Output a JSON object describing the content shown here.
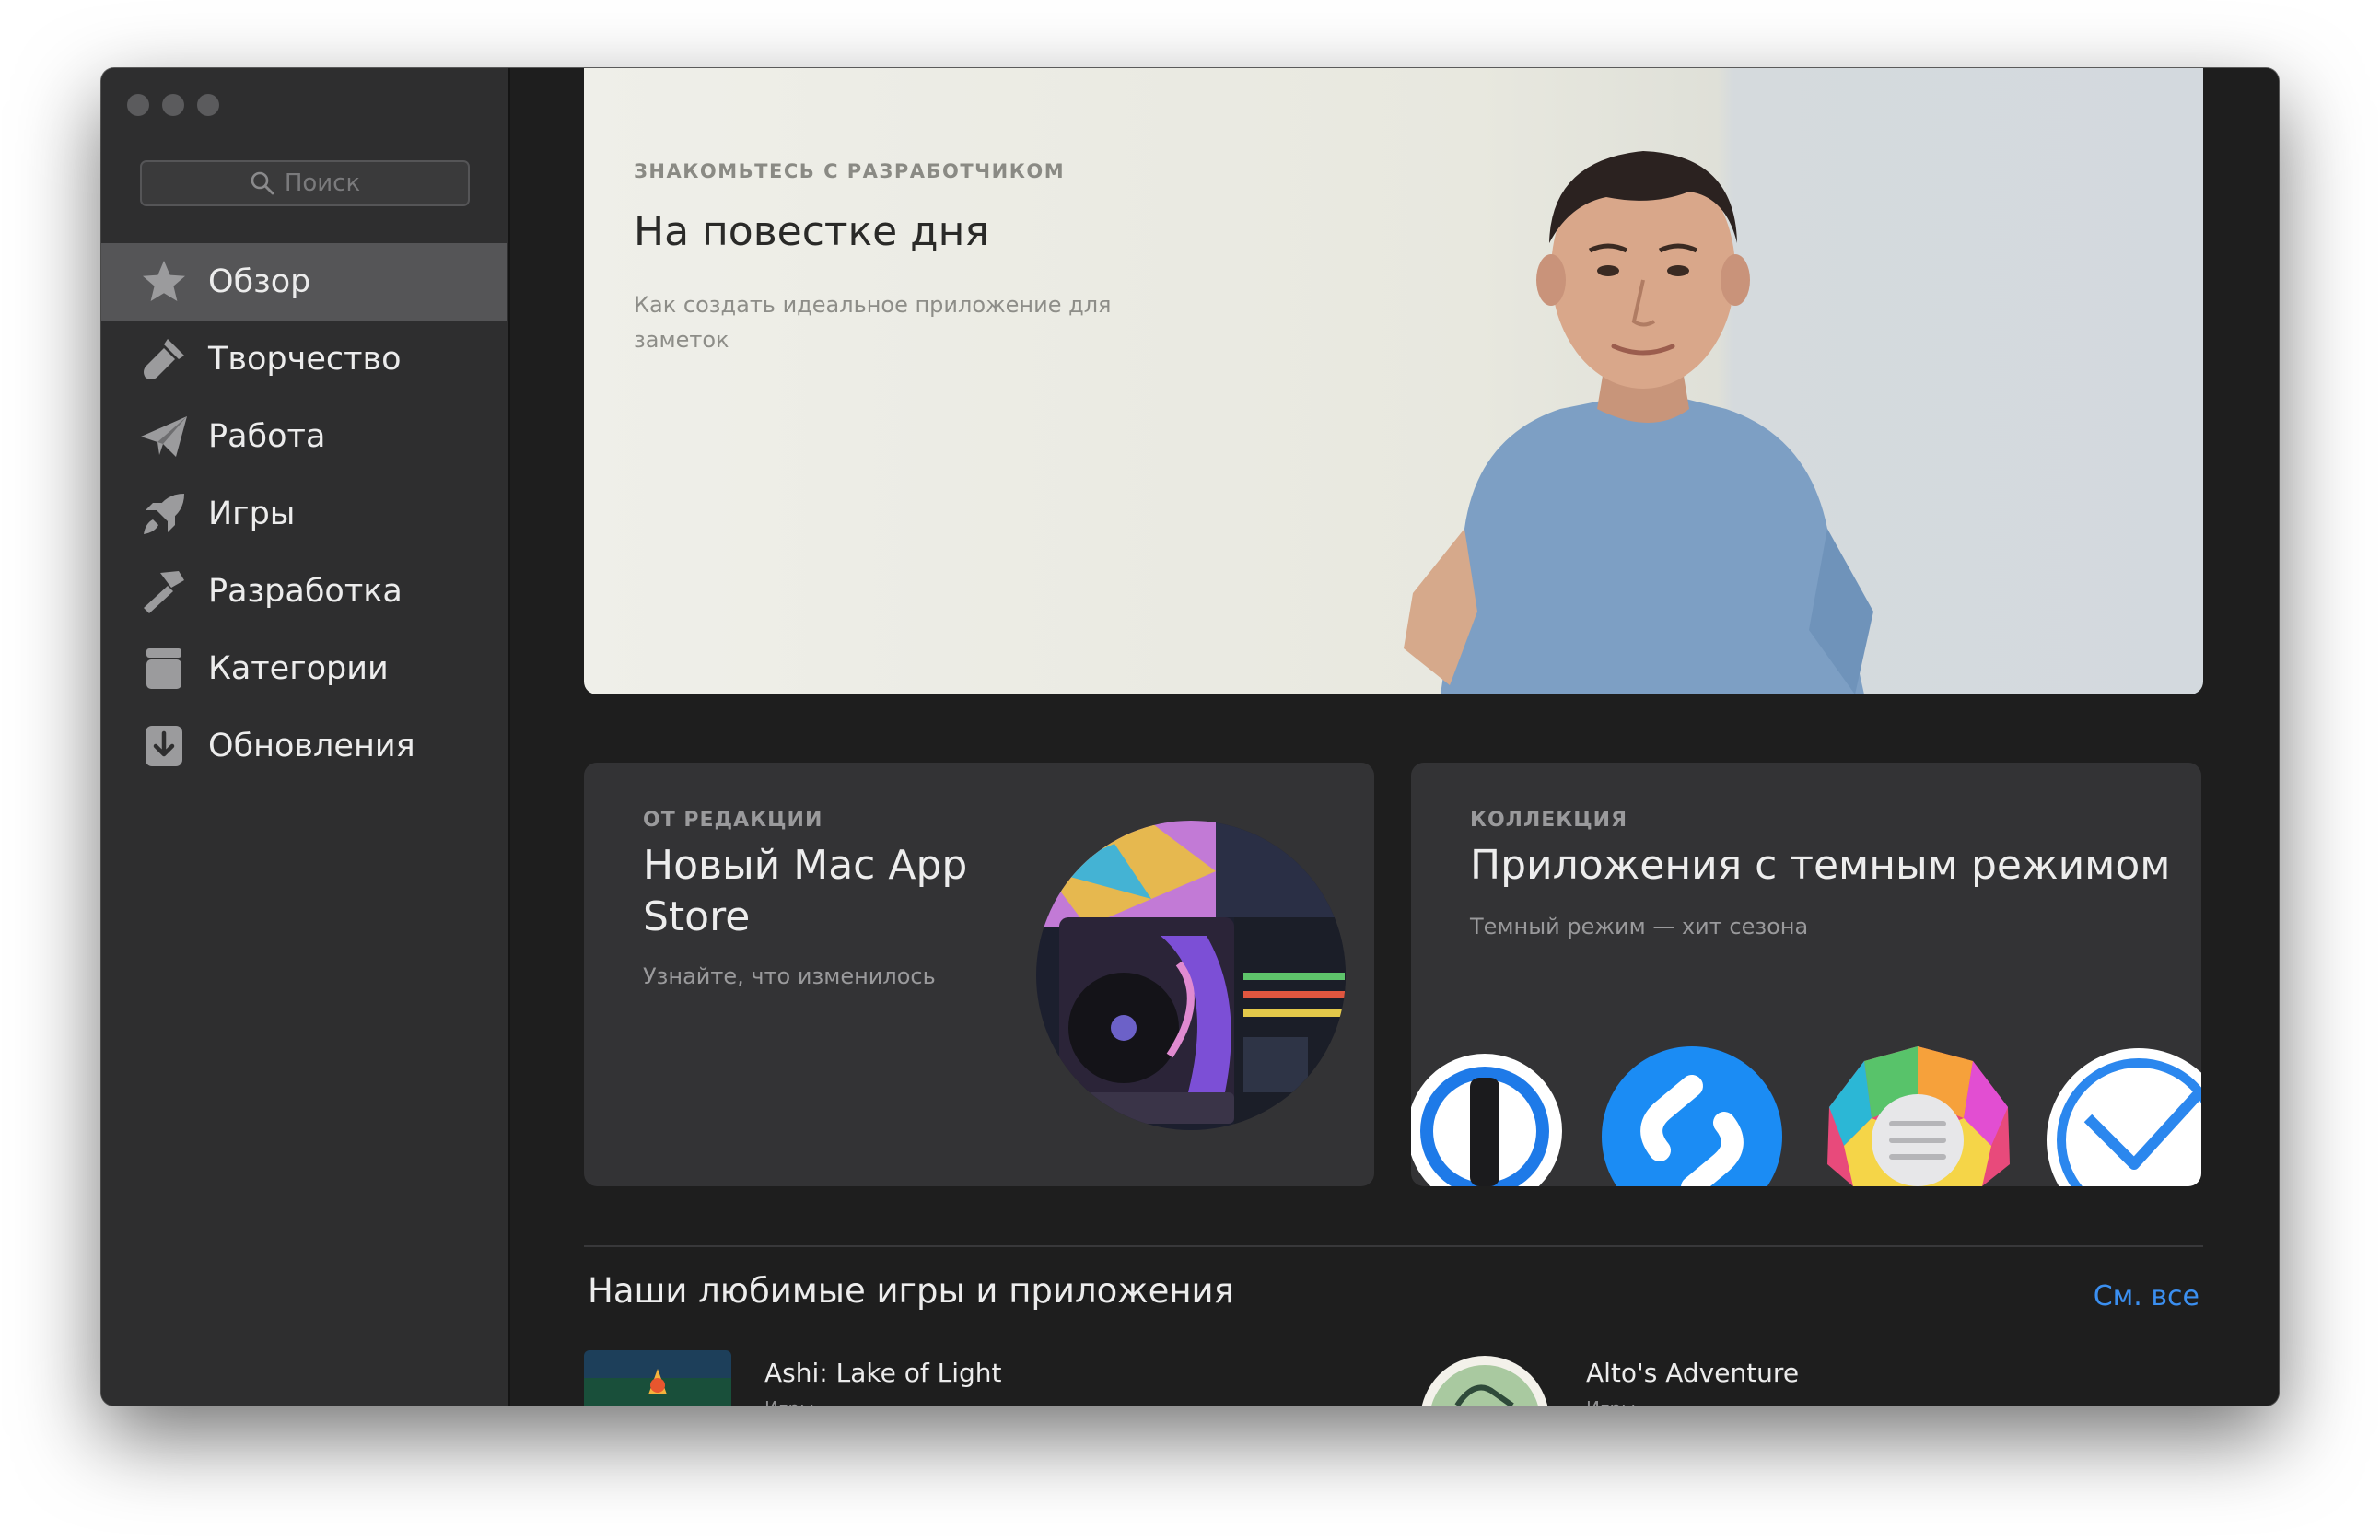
{
  "sidebar": {
    "search_placeholder": "Поиск",
    "items": [
      {
        "label": "Обзор",
        "icon": "star-icon",
        "active": true
      },
      {
        "label": "Творчество",
        "icon": "brush-icon"
      },
      {
        "label": "Работа",
        "icon": "paper-plane-icon"
      },
      {
        "label": "Игры",
        "icon": "rocket-icon"
      },
      {
        "label": "Разработка",
        "icon": "hammer-icon"
      },
      {
        "label": "Категории",
        "icon": "box-icon"
      },
      {
        "label": "Обновления",
        "icon": "download-icon"
      }
    ]
  },
  "hero": {
    "kicker": "ЗНАКОМЬТЕСЬ С РАЗРАБОТЧИКОМ",
    "title": "На повестке дня",
    "subtitle": "Как создать идеальное приложение для заметок"
  },
  "card_editorial": {
    "kicker": "ОТ РЕДАКЦИИ",
    "title": "Новый Mac App Store",
    "subtitle": "Узнайте, что изменилось"
  },
  "card_collection": {
    "kicker": "КОЛЛЕКЦИЯ",
    "title": "Приложения с темным режимом",
    "subtitle": "Темный режим — хит сезона"
  },
  "favorites": {
    "title": "Наши любимые игры и приложения",
    "see_all": "См. все",
    "apps": [
      {
        "name": "Ashi: Lake of Light",
        "category": "Игры"
      },
      {
        "name": "Alto's Adventure",
        "category": "Игры"
      }
    ]
  },
  "colors": {
    "accent": "#3b8ff0",
    "sidebar_bg": "#2e2e2f",
    "main_bg": "#1e1e1e",
    "card_bg": "#333335"
  }
}
